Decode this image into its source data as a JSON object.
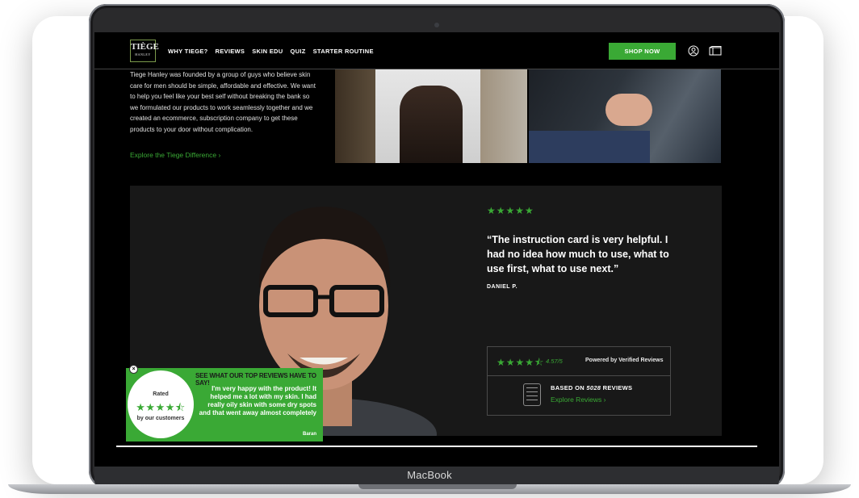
{
  "device": {
    "label": "MacBook"
  },
  "header": {
    "logo": {
      "main": "TIÈGE",
      "sub": "HANLEY"
    },
    "nav": [
      "WHY TIEGE?",
      "REVIEWS",
      "SKIN EDU",
      "QUIZ",
      "STARTER ROUTINE"
    ],
    "shop_button": "SHOP NOW",
    "icons": [
      "account-icon",
      "cart-icon"
    ]
  },
  "intro": {
    "text": "Tiege Hanley was founded by a group of guys who believe skin care for men should be simple, affordable and effective. We want to help you feel like your best self without breaking the bank so we formulated our products to work seamlessly together and we created an ecommerce, subscription company to get these products to your door without complication.",
    "link": "Explore the Tiege Difference ›"
  },
  "review": {
    "stars": "★★★★★",
    "quote": "“The instruction card is very helpful. I had no idea how much to use, what to use first, what to use next.”",
    "author": "DANIEL P."
  },
  "rating_box": {
    "stars": "★★★★⯪",
    "score": "4.57/5",
    "powered_by": "Powered by Verified Reviews",
    "based_on_prefix": "BASED ON ",
    "review_count": "5028",
    "based_on_suffix": " REVIEWS",
    "explore_link": "Explore Reviews ›"
  },
  "widget": {
    "close": "×",
    "badge_rated": "Rated",
    "badge_stars": "★★★★⯪",
    "badge_by": "by our customers",
    "heading": "SEE WHAT OUR TOP REVIEWS HAVE TO SAY!",
    "text": "I'm very happy with the product! It helped me a lot with my skin. I had really oily skin with some dry spots and that went away almost completely",
    "author": "Baran"
  },
  "colors": {
    "accent": "#3aa935",
    "background": "#000000",
    "panel": "#181818"
  }
}
